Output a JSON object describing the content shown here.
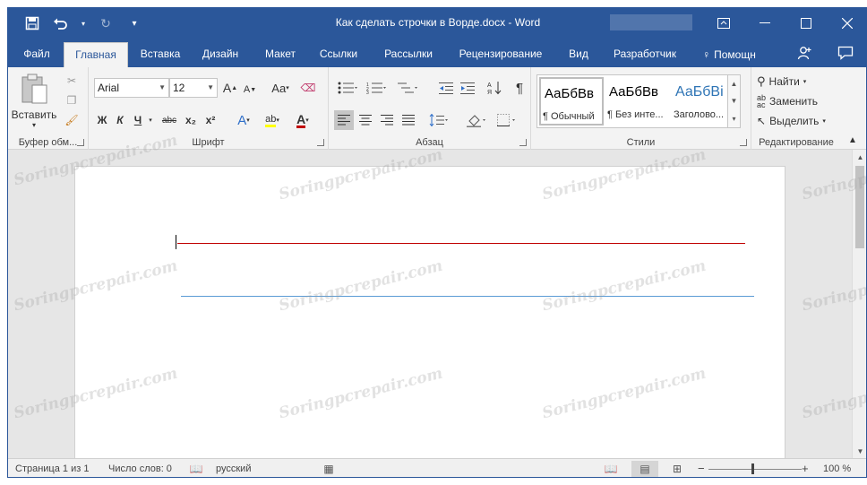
{
  "window": {
    "title": "Как сделать строчки в Ворде.docx - Word"
  },
  "tabs": [
    {
      "label": "Файл"
    },
    {
      "label": "Главная"
    },
    {
      "label": "Вставка"
    },
    {
      "label": "Дизайн"
    },
    {
      "label": "Макет"
    },
    {
      "label": "Ссылки"
    },
    {
      "label": "Рассылки"
    },
    {
      "label": "Рецензирование"
    },
    {
      "label": "Вид"
    },
    {
      "label": "Разработчик"
    },
    {
      "label": "Помощн"
    }
  ],
  "active_tab": "Главная",
  "ribbon": {
    "clipboard": {
      "label": "Буфер обм...",
      "paste_label": "Вставить"
    },
    "font": {
      "label": "Шрифт",
      "font_name": "Arial",
      "font_size": "12",
      "bold": "Ж",
      "italic": "К",
      "underline": "Ч",
      "strikethrough": "abc",
      "subscript": "x₂",
      "superscript": "x²",
      "grow": "A",
      "shrink": "A",
      "change_case": "Aa",
      "text_effects": "A",
      "highlight": "ab",
      "font_color": "A"
    },
    "paragraph": {
      "label": "Абзац"
    },
    "styles": {
      "label": "Стили",
      "items": [
        {
          "sample": "АаБбВв",
          "name": "¶ Обычный"
        },
        {
          "sample": "АаБбВв",
          "name": "¶ Без инте..."
        },
        {
          "sample": "АаБбВі",
          "name": "Заголово..."
        }
      ]
    },
    "editing": {
      "label": "Редактирование",
      "find": "Найти",
      "replace": "Заменить",
      "select": "Выделить"
    }
  },
  "status": {
    "page": "Страница 1 из 1",
    "words": "Число слов: 0",
    "language": "русский",
    "zoom": "100 %",
    "zoom_level_percent": 100
  },
  "watermark": "Soringpcrepair.com",
  "colors": {
    "brand": "#2b579a",
    "line_top": "#c00000",
    "line_bottom": "#5b9bd5"
  }
}
